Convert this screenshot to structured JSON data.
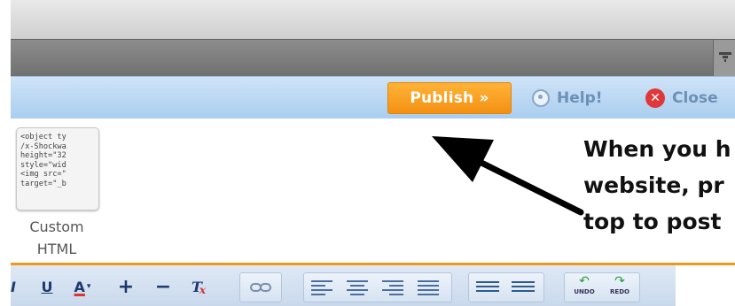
{
  "header": {
    "publish_label": "Publish »",
    "help_label": "Help!",
    "close_label": "Close"
  },
  "panel": {
    "custom_html_code": "<object ty\n/x-Shockwa\nheight=\"32\nstyle=\"wid\n<img src=\"\ntarget=\"_b",
    "custom_html_label_1": "Custom",
    "custom_html_label_2": "HTML"
  },
  "annotation": {
    "text": "When you h\nwebsite, pr\ntop to post"
  },
  "toolbar": {
    "italic": "I",
    "underline": "U",
    "font_color": "A",
    "font_color_caret": "▾",
    "increase_size": "+",
    "decrease_size": "−",
    "clear_format": "T",
    "undo_label": "UNDO",
    "redo_label": "REDO"
  },
  "colors": {
    "publish": "#f39113",
    "blue_bar": "#a9cdef",
    "annotation_arrow": "#000000",
    "separator": "#f0981d"
  },
  "icons": [
    "filter-icon",
    "help-icon",
    "close-icon",
    "link-icon",
    "align-left-icon",
    "align-center-icon",
    "align-right-icon",
    "justify-icon",
    "bullet-list-icon",
    "numbered-list-icon",
    "undo-icon",
    "redo-icon"
  ]
}
